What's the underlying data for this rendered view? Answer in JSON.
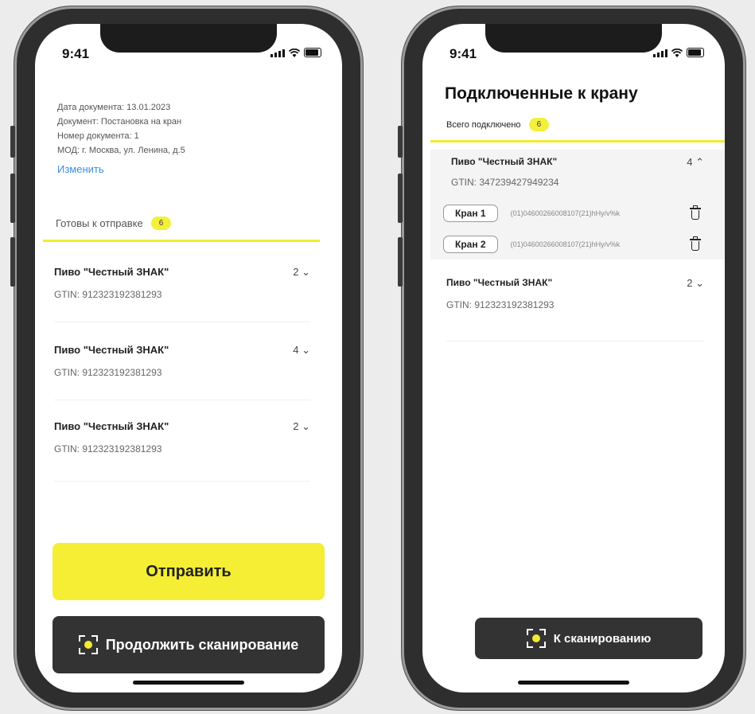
{
  "left_screen": {
    "status": {
      "time": "9:41"
    },
    "doc_info": {
      "date": "Дата документа: 13.01.2023",
      "document": "Документ: Постановка на кран",
      "number": "Номер документа: 1",
      "mod": "МОД: г. Москва, ул. Ленина, д.5",
      "edit_link": "Изменить"
    },
    "section": {
      "title": "Готовы к отправке",
      "badge": "6"
    },
    "items": [
      {
        "name": "Пиво \"Честный ЗНАК\"",
        "gtin": "GTIN: 912323192381293",
        "count": "2 ⌄"
      },
      {
        "name": "Пиво \"Честный ЗНАК\"",
        "gtin": "GTIN: 912323192381293",
        "count": "4 ⌄"
      },
      {
        "name": "Пиво \"Честный ЗНАК\"",
        "gtin": "GTIN: 912323192381293",
        "count": "2 ⌄"
      }
    ],
    "send_button": "Отправить",
    "continue_button": "Продолжить сканирование"
  },
  "right_screen": {
    "status": {
      "time": "9:41"
    },
    "title": "Подключенные к крану",
    "total": {
      "label": "Всего подключено",
      "badge": "6"
    },
    "expanded_item": {
      "name": "Пиво \"Честный ЗНАК\"",
      "gtin": "GTIN: 347239427949234",
      "count": "4 ⌃",
      "taps": [
        {
          "label": "Кран 1",
          "code": "(01)04600266008107(21)hHy/v%k"
        },
        {
          "label": "Кран 2",
          "code": "(01)04600266008107(21)hHy/v%k"
        }
      ]
    },
    "item": {
      "name": "Пиво \"Честный ЗНАК\"",
      "gtin": "GTIN: 912323192381293",
      "count": "2 ⌄"
    },
    "scan_button": "К сканированию"
  },
  "colors": {
    "accent_yellow": "#f5ee34",
    "dark_button": "#333333",
    "link_blue": "#3a8de0"
  },
  "icons": [
    "signal-icon",
    "wifi-icon",
    "battery-icon",
    "scan-icon",
    "trash-icon",
    "chevron-down-icon",
    "chevron-up-icon"
  ]
}
